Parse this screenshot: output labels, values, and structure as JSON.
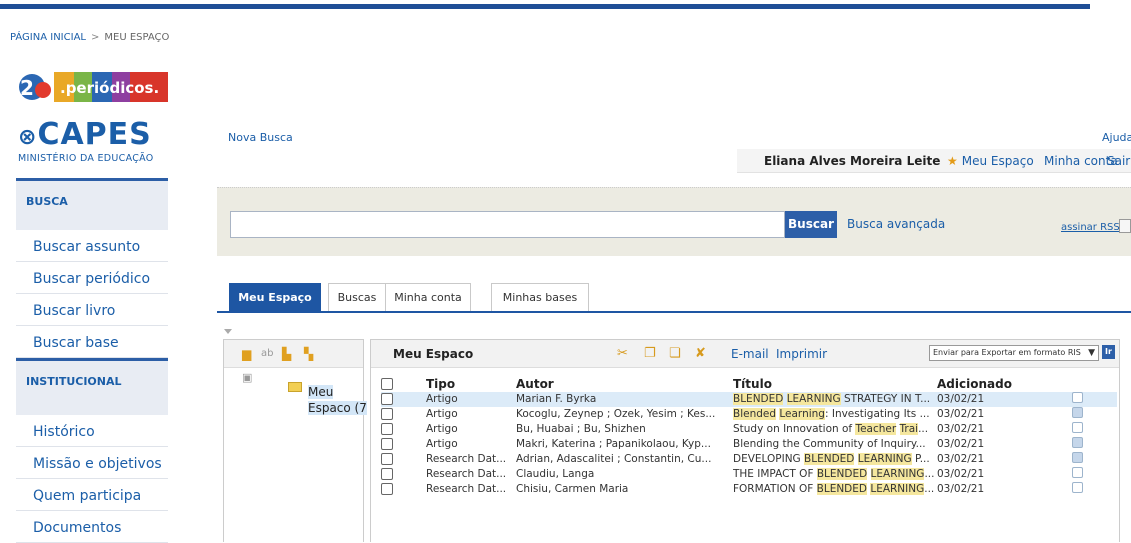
{
  "breadcrumb": {
    "home": "PÁGINA INICIAL",
    "separator": ">",
    "current": "MEU ESPAÇO"
  },
  "logo": {
    "badge_number": "20",
    "name": ".periódicos."
  },
  "capes": {
    "title": "CAPES",
    "subtitle": "MINISTÉRIO DA EDUCAÇÃO"
  },
  "sidebar": {
    "busca_label": "BUSCA",
    "busca_items": [
      "Buscar assunto",
      "Buscar periódico",
      "Buscar livro",
      "Buscar base"
    ],
    "institucional_label": "INSTITUCIONAL",
    "institucional_items": [
      "Histórico",
      "Missão e objetivos",
      "Quem participa",
      "Documentos"
    ]
  },
  "header": {
    "nova_busca": "Nova Busca",
    "ajuda": "Ajuda",
    "user_name": "Eliana Alves Moreira Leite",
    "meu_espaco": "Meu Espaço",
    "minha_conta": "Minha conta",
    "sair": "Sair"
  },
  "search": {
    "value": "",
    "button": "Buscar",
    "advanced": "Busca avançada",
    "rss": "assinar RSS"
  },
  "tabs": [
    "Meu Espaço",
    "Buscas",
    "Minha conta",
    "Minhas bases"
  ],
  "tree": {
    "folder_label_1": "Meu",
    "folder_label_2": "Espaco (7"
  },
  "results": {
    "title": "Meu Espaco",
    "email": "E-mail",
    "print": "Imprimir",
    "export_selected": "Enviar para Exportar em formato RIS",
    "columns": {
      "tipo": "Tipo",
      "autor": "Autor",
      "titulo": "Título",
      "adicionado": "Adicionado"
    },
    "rows": [
      {
        "tipo": "Artigo",
        "autor": "Marian F. Byrka",
        "titulo_pre": "",
        "titulo_hl": "BLENDED",
        "titulo_mid": " ",
        "titulo_hl2": "LEARNING",
        "titulo_post": " STRATEGY IN T...",
        "date": "03/02/21"
      },
      {
        "tipo": "Artigo",
        "autor": "Kocoglu, Zeynep ; Ozek, Yesim ; Kes...",
        "titulo_pre": "",
        "titulo_hl": "Blended",
        "titulo_mid": " ",
        "titulo_hl2": "Learning",
        "titulo_post": ": Investigating Its ...",
        "date": "03/02/21"
      },
      {
        "tipo": "Artigo",
        "autor": "Bu, Huabai ; Bu, Shizhen",
        "titulo_pre": "Study on Innovation of ",
        "titulo_hl": "Teacher",
        "titulo_mid": " ",
        "titulo_hl2": "Trai",
        "titulo_post": "...",
        "date": "03/02/21"
      },
      {
        "tipo": "Artigo",
        "autor": "Makri, Katerina ; Papanikolaou, Kyp...",
        "titulo_pre": "Blending the Community of Inquiry...",
        "titulo_hl": "",
        "titulo_mid": "",
        "titulo_hl2": "",
        "titulo_post": "",
        "date": "03/02/21"
      },
      {
        "tipo": "Research Dat...",
        "autor": "Adrian, Adascalitei ; Constantin, Cu...",
        "titulo_pre": "DEVELOPING ",
        "titulo_hl": "BLENDED",
        "titulo_mid": " ",
        "titulo_hl2": "LEARNING",
        "titulo_post": " P...",
        "date": "03/02/21"
      },
      {
        "tipo": "Research Dat...",
        "autor": "Claudiu, Langa",
        "titulo_pre": "THE IMPACT OF ",
        "titulo_hl": "BLENDED",
        "titulo_mid": " ",
        "titulo_hl2": "LEARNING",
        "titulo_post": "...",
        "date": "03/02/21"
      },
      {
        "tipo": "Research Dat...",
        "autor": "Chisiu, Carmen Maria",
        "titulo_pre": "FORMATION OF ",
        "titulo_hl": "BLENDED",
        "titulo_mid": " ",
        "titulo_hl2": "LEARNING",
        "titulo_post": "...",
        "date": "03/02/21"
      }
    ]
  },
  "colors": {
    "brand_blue": "#1f4e96",
    "link": "#1b5ea8",
    "highlight": "#f5e79e",
    "selected_row": "#dcebf8"
  }
}
